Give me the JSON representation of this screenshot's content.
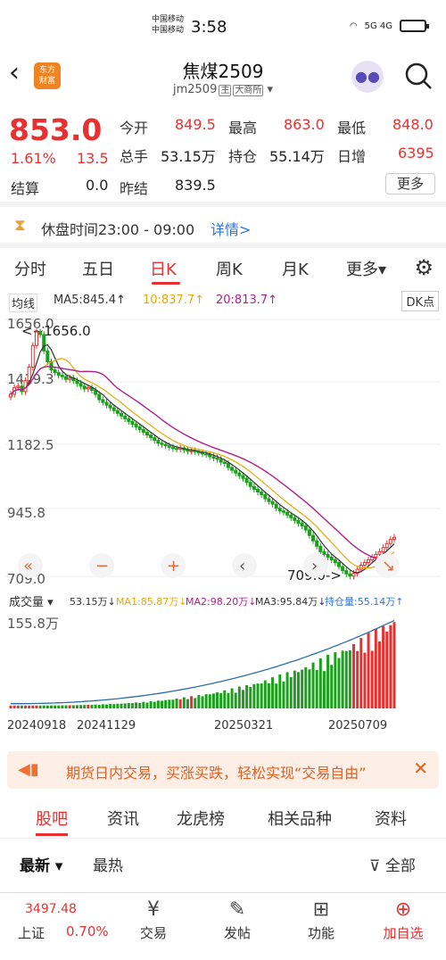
{
  "status": {
    "carrier1": "中国移动",
    "carrier2": "中国移动",
    "time": "3:58",
    "signal": "5G 4G"
  },
  "header": {
    "title": "焦煤2509",
    "code": "jm2509",
    "tag1": "主",
    "tag2": "大商所",
    "logo_line1": "东方",
    "logo_line2": "财富"
  },
  "quote": {
    "price": "853.0",
    "pct": "1.61%",
    "change": "13.5",
    "items": [
      {
        "label": "今开",
        "value": "849.5"
      },
      {
        "label": "最高",
        "value": "863.0"
      },
      {
        "label": "最低",
        "value": "848.0"
      },
      {
        "label": "总手",
        "value": "53.15万"
      },
      {
        "label": "持仓",
        "value": "55.14万"
      },
      {
        "label": "日增",
        "value": "6395"
      }
    ],
    "settle_label": "结算",
    "settle_value": "0.0",
    "prev_settle_label": "昨结",
    "prev_settle_value": "839.5",
    "more": "更多"
  },
  "break_info": {
    "text": "休盘时间23:00 - 09:00",
    "detail": "详情>"
  },
  "tabs": [
    "分时",
    "五日",
    "日K",
    "周K",
    "月K",
    "更多"
  ],
  "ma": {
    "type": "均线",
    "ma5": "MA5:845.4↑",
    "ma10": "10:837.7↑",
    "ma20": "20:813.7↑",
    "dk": "DK点",
    "c_ma5": "#333333",
    "c_ma10": "#e9a900",
    "c_ma20": "#b0208c"
  },
  "chart_data": {
    "type": "candlestick",
    "y_ticks": [
      "1656.0",
      "1419.3",
      "1182.5",
      "945.8",
      "709.0"
    ],
    "max_label": "1656.0",
    "min_label": "709.0",
    "close": [
      1380,
      1405,
      1410,
      1390,
      1430,
      1480,
      1560,
      1610,
      1600,
      1540,
      1500,
      1470,
      1460,
      1450,
      1445,
      1435,
      1440,
      1430,
      1420,
      1410,
      1400,
      1405,
      1395,
      1380,
      1360,
      1350,
      1340,
      1330,
      1320,
      1310,
      1300,
      1290,
      1280,
      1270,
      1260,
      1250,
      1240,
      1230,
      1220,
      1210,
      1200,
      1195,
      1190,
      1185,
      1180,
      1178,
      1182,
      1175,
      1170,
      1172,
      1168,
      1165,
      1160,
      1158,
      1150,
      1145,
      1140,
      1130,
      1125,
      1110,
      1100,
      1090,
      1080,
      1070,
      1055,
      1040,
      1030,
      1020,
      1010,
      995,
      985,
      975,
      960,
      950,
      945,
      935,
      925,
      915,
      905,
      895,
      880,
      860,
      840,
      820,
      800,
      790,
      780,
      770,
      760,
      745,
      730,
      718,
      710,
      720,
      735,
      750,
      760,
      770,
      780,
      790,
      800,
      815,
      830,
      845,
      853
    ],
    "volume_max": "155.8万",
    "x_labels": [
      "20240918",
      "20241129",
      "20250321",
      "20250709"
    ]
  },
  "volume": {
    "label": "成交量",
    "v": "53.15万↓",
    "ma1": "MA1:85.87万↓",
    "ma2": "MA2:98.20万↓",
    "ma3": "MA3:95.84万↓",
    "oi": "持仓量:55.14万↑"
  },
  "banner": {
    "text": "期货日内交易，买涨买跌，轻松实现“交易自由”"
  },
  "bottom_tabs": [
    "股吧",
    "资讯",
    "龙虎榜",
    "相关品种",
    "资料"
  ],
  "sort": {
    "latest": "最新",
    "hot": "最热",
    "all": "全部"
  },
  "tabbar": {
    "index_value": "3497.48",
    "index_name": "上证",
    "index_pct": "0.70%",
    "items": [
      "交易",
      "发帖",
      "功能",
      "加自选"
    ]
  }
}
